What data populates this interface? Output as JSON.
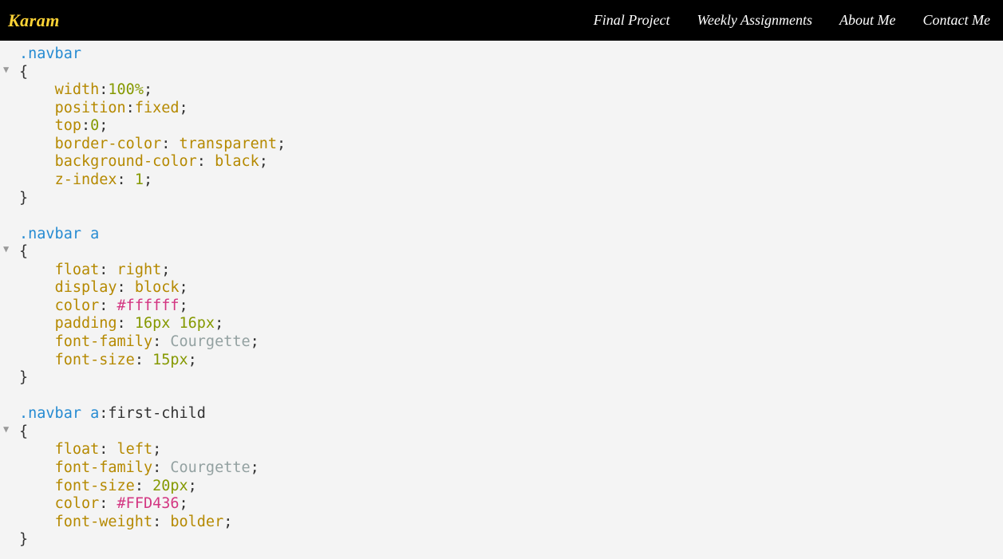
{
  "navbar": {
    "brand": "Karam",
    "links": [
      "Final Project",
      "Weekly Assignments",
      "About Me",
      "Contact Me"
    ]
  },
  "code": {
    "block1": {
      "selector": ".navbar",
      "open": "{",
      "lines": [
        {
          "prop": "width",
          "val_num": "100%",
          "sc": ";"
        },
        {
          "prop": "position",
          "val_kw": "fixed",
          "sc": ";"
        },
        {
          "prop": "top",
          "val_num": "0",
          "sc": ";"
        },
        {
          "prop": "border-color",
          "sp": " ",
          "val_kw": "transparent",
          "sc": ";"
        },
        {
          "prop": "background-color",
          "sp": " ",
          "val_kw": "black",
          "sc": ";"
        },
        {
          "prop": "z-index",
          "sp": " ",
          "val_num": "1",
          "sc": ";"
        }
      ],
      "close": "}"
    },
    "block2": {
      "selector_cls": ".navbar",
      "sp": " ",
      "selector_tag": "a",
      "open": "{",
      "lines": [
        {
          "prop": "float",
          "sp": " ",
          "val_kw": "right",
          "sc": ";"
        },
        {
          "prop": "display",
          "sp": " ",
          "val_kw": "block",
          "sc": ";"
        },
        {
          "prop": "color",
          "sp": " ",
          "val_hex": "#ffffff",
          "sc": ";"
        },
        {
          "prop": "padding",
          "sp": " ",
          "val_num": "16px",
          "sp2": " ",
          "val_num2": "16px",
          "sc": ";"
        },
        {
          "prop": "font-family",
          "sp": " ",
          "val_plain": "Courgette",
          "sc": ";"
        },
        {
          "prop": "font-size",
          "sp": " ",
          "val_num": "15px",
          "sc": ";"
        }
      ],
      "close": "}"
    },
    "block3": {
      "selector_cls": ".navbar",
      "sp": " ",
      "selector_tag": "a",
      "pseudo": ":first-child",
      "open": "{",
      "lines": [
        {
          "prop": "float",
          "sp": " ",
          "val_kw": "left",
          "sc": ";"
        },
        {
          "prop": "font-family",
          "sp": " ",
          "val_plain": "Courgette",
          "sc": ";"
        },
        {
          "prop": "font-size",
          "sp": " ",
          "val_num": "20px",
          "sc": ";"
        },
        {
          "prop": "color",
          "sp": " ",
          "val_hex": "#FFD436",
          "sc": ";"
        },
        {
          "prop": "font-weight",
          "sp": " ",
          "val_kw": "bolder",
          "sc": ";"
        }
      ],
      "close": "}"
    }
  },
  "fold_marker": "▼"
}
